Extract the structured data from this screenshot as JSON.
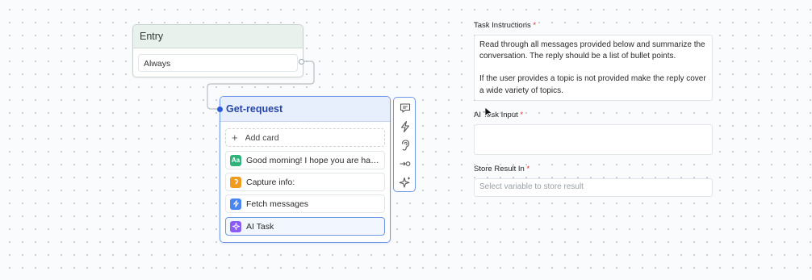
{
  "canvas": {
    "entry_node": {
      "title": "Entry",
      "trigger_label": "Always"
    },
    "get_request_node": {
      "title": "Get-request",
      "add_card_label": "Add card",
      "cards": [
        {
          "icon": "text-message-icon",
          "icon_text": "Aa",
          "color": "#2fb37a",
          "label": "Good morning! I hope you are havi..."
        },
        {
          "icon": "capture-icon",
          "color": "#f29c1f",
          "label": "Capture info:"
        },
        {
          "icon": "lightning-icon",
          "color": "#4b86f0",
          "label": "Fetch messages"
        },
        {
          "icon": "sparkle-icon",
          "color": "#8b5cf6",
          "label": "AI Task"
        }
      ]
    },
    "node_toolbar": [
      "message-icon",
      "lightning-icon",
      "ear-icon",
      "connect-icon",
      "sparkle-icon"
    ]
  },
  "panel": {
    "task_instructions": {
      "label": "Task Instructions",
      "required_mark": "*",
      "value_line1": "Read through all messages provided below and summarize the conversation. The reply should be a list of bullet points.",
      "value_line2": "If the user provides a topic is not provided make the reply cover a wide variety of topics."
    },
    "ai_task_input": {
      "label": "AI Task Input",
      "required_mark": "*",
      "value": ""
    },
    "store_result": {
      "label": "Store Result In",
      "required_mark": "*",
      "placeholder": "Select variable to store result"
    }
  },
  "colors": {
    "accent": "#6e97ea",
    "entry_header": "#e8f1ec",
    "required": "#d93025"
  }
}
